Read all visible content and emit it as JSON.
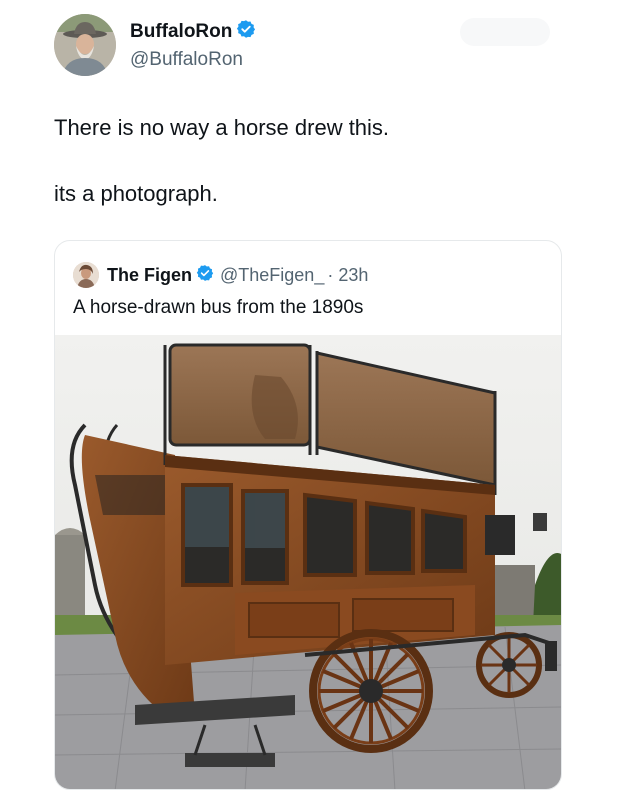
{
  "author": {
    "display_name": "BuffaloRon",
    "handle": "@BuffaloRon",
    "avatar_icon": "avatar-icon",
    "verified_icon": "verified-badge-icon"
  },
  "tweet": {
    "line1": "There is no way a horse drew this.",
    "line2": "its a photograph."
  },
  "quoted": {
    "display_name": "The Figen",
    "handle": "@TheFigen_",
    "time": "· 23h",
    "text": "A horse-drawn bus from the 1890s",
    "verified_icon": "verified-badge-icon",
    "image_subject": "horse-drawn-bus-photo"
  },
  "colors": {
    "verified_blue": "#1d9bf0",
    "secondary_text": "#536471",
    "border": "#e6e9eb"
  }
}
